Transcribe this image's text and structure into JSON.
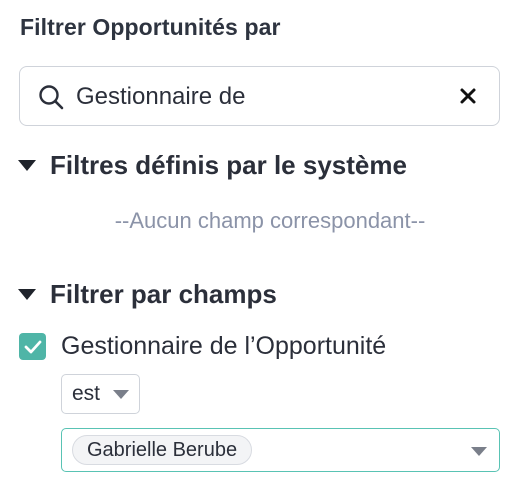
{
  "panel": {
    "title": "Filtrer Opportunités par"
  },
  "search": {
    "value": "Gestionnaire de",
    "icon": "search-icon",
    "clear_icon": "close-icon"
  },
  "system_filters": {
    "label": "Filtres définis par le système",
    "expanded": true,
    "empty_text": "--Aucun champ correspondant--"
  },
  "field_filters": {
    "label": "Filtrer par champs",
    "expanded": true,
    "field": {
      "label": "Gestionnaire de l’Opportunité",
      "checked": true,
      "operator": "est",
      "selected_values": [
        "Gabrielle Berube"
      ]
    }
  },
  "colors": {
    "accent": "#4fb5a7",
    "focus_border": "#59c3b4",
    "muted_text": "#8b93a8"
  }
}
